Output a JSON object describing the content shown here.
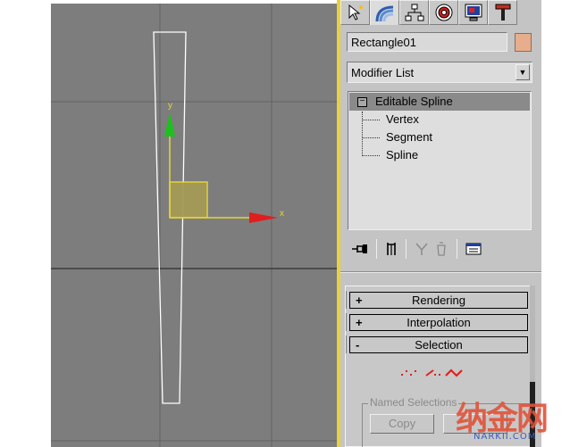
{
  "viewport": {
    "axis_x_label": "x",
    "axis_y_label": "y",
    "grid_color": "#555555",
    "background": "#7d7d7d",
    "spline_color": "#ffffff",
    "gizmo_x_color": "#e02020",
    "gizmo_y_color": "#20c020"
  },
  "command_panel": {
    "tabs": [
      {
        "name": "create-tab",
        "icon": "cursor-star-icon"
      },
      {
        "name": "modify-tab",
        "icon": "rainbow-arc-icon"
      },
      {
        "name": "hierarchy-tab",
        "icon": "hierarchy-icon"
      },
      {
        "name": "motion-tab",
        "icon": "motion-icon"
      },
      {
        "name": "display-tab",
        "icon": "display-monitor-icon"
      },
      {
        "name": "utilities-tab",
        "icon": "hammer-icon"
      }
    ],
    "object_name": "Rectangle01",
    "object_color": "#e6ae8c",
    "modifier_list_label": "Modifier List",
    "stack": {
      "selected": "Editable Spline",
      "sub_objects": [
        "Vertex",
        "Segment",
        "Spline"
      ]
    },
    "rollouts": [
      {
        "sign": "+",
        "label": "Rendering"
      },
      {
        "sign": "+",
        "label": "Interpolation"
      },
      {
        "sign": "-",
        "label": "Selection"
      }
    ],
    "named_selections": {
      "label": "Named Selections",
      "copy_label": "Copy"
    }
  },
  "watermark": {
    "chinese": "纳金网",
    "url": "NARKII.COM"
  }
}
